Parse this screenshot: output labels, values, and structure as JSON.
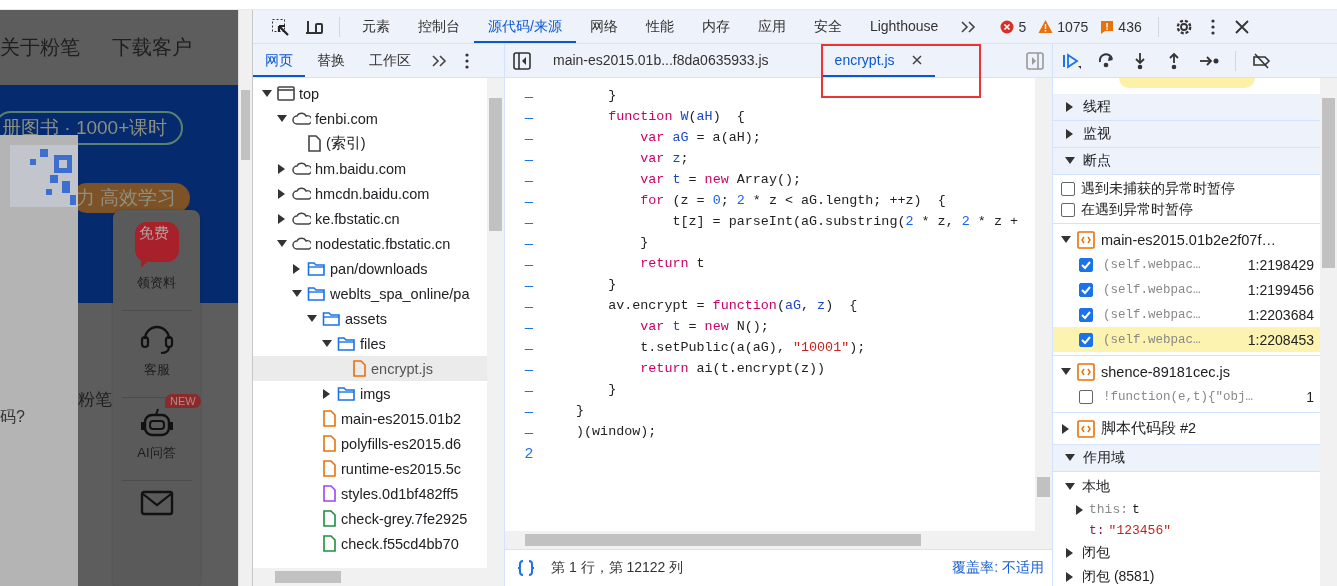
{
  "page": {
    "nav": [
      "关于粉笔",
      "下载客户"
    ],
    "pills": [
      {
        "text": "册图书 · 1000+课时",
        "kind": "outline"
      },
      {
        "text": "力 高效学习",
        "kind": "filled"
      }
    ],
    "login_hint": "码?",
    "brand_text": "粉笔",
    "side_menu": [
      {
        "kind": "gift",
        "badge": "免费",
        "label": "领资料"
      },
      {
        "kind": "headset",
        "label": "客服"
      },
      {
        "kind": "robot",
        "badge": "NEW",
        "label": "AI问答"
      },
      {
        "kind": "mail"
      }
    ]
  },
  "devtools": {
    "tabs": [
      {
        "label": "元素",
        "selected": false
      },
      {
        "label": "控制台",
        "selected": false
      },
      {
        "label": "源代码/来源",
        "selected": true
      },
      {
        "label": "网络",
        "selected": false
      },
      {
        "label": "性能",
        "selected": false
      },
      {
        "label": "内存",
        "selected": false
      },
      {
        "label": "应用",
        "selected": false
      },
      {
        "label": "安全",
        "selected": false
      },
      {
        "label": "Lighthouse",
        "selected": false
      }
    ],
    "counters": [
      {
        "kind": "error",
        "count": "5"
      },
      {
        "kind": "warning",
        "count": "1075"
      },
      {
        "kind": "issue",
        "count": "436"
      }
    ],
    "navigator": {
      "tabs": [
        {
          "label": "网页",
          "selected": true
        },
        {
          "label": "替换",
          "selected": false
        },
        {
          "label": "工作区",
          "selected": false
        }
      ],
      "tree": [
        {
          "label": "top",
          "kind": "frame",
          "expanded": true,
          "selected": false,
          "children": [
            {
              "label": "fenbi.com",
              "kind": "domain",
              "expanded": true,
              "selected": false,
              "children": [
                {
                  "label": "(索引)",
                  "kind": "document",
                  "selected": false
                }
              ]
            },
            {
              "label": "hm.baidu.com",
              "kind": "domain",
              "expanded": false,
              "selected": false
            },
            {
              "label": "hmcdn.baidu.com",
              "kind": "domain",
              "expanded": false,
              "selected": false
            },
            {
              "label": "ke.fbstatic.cn",
              "kind": "domain",
              "expanded": false,
              "selected": false
            },
            {
              "label": "nodestatic.fbstatic.cn",
              "kind": "domain",
              "expanded": true,
              "selected": false,
              "children": [
                {
                  "label": "pan/downloads",
                  "kind": "folder",
                  "expanded": false,
                  "selected": false
                },
                {
                  "label": "weblts_spa_online/pa",
                  "kind": "folder",
                  "expanded": true,
                  "selected": false,
                  "children": [
                    {
                      "label": "assets",
                      "kind": "folder",
                      "expanded": true,
                      "selected": false,
                      "children": [
                        {
                          "label": "files",
                          "kind": "folder",
                          "expanded": true,
                          "selected": false,
                          "children": [
                            {
                              "label": "encrypt.js",
                              "kind": "script",
                              "selected": true
                            }
                          ]
                        },
                        {
                          "label": "imgs",
                          "kind": "folder",
                          "expanded": false,
                          "selected": false
                        }
                      ]
                    },
                    {
                      "label": "main-es2015.01b2",
                      "kind": "script",
                      "selected": false
                    },
                    {
                      "label": "polyfills-es2015.d6",
                      "kind": "script",
                      "selected": false
                    },
                    {
                      "label": "runtime-es2015.5c",
                      "kind": "script",
                      "selected": false
                    },
                    {
                      "label": "styles.0d1bf482ff5",
                      "kind": "stylesheet",
                      "selected": false
                    },
                    {
                      "label": "check-grey.7fe2925",
                      "kind": "image",
                      "selected": false
                    },
                    {
                      "label": "check.f55cd4bb70",
                      "kind": "image",
                      "selected": false
                    }
                  ]
                }
              ]
            }
          ]
        }
      ]
    },
    "editor": {
      "tabs": [
        {
          "label": "main-es2015.01b...f8da0635933.js",
          "selected": false,
          "closable": false
        },
        {
          "label": "encrypt.js",
          "selected": true,
          "closable": true
        }
      ],
      "lines": [
        {
          "gutter": "–",
          "tokens": [
            {
              "t": "    }",
              "kind": "plain"
            }
          ]
        },
        {
          "gutter": "–",
          "tokens": [
            {
              "t": "    function ",
              "kind": "kw"
            },
            {
              "t": "W",
              "kind": "def"
            },
            {
              "t": "(",
              "kind": "plain"
            },
            {
              "t": "aH",
              "kind": "def"
            },
            {
              "t": ")  {",
              "kind": "plain"
            }
          ]
        },
        {
          "gutter": "–",
          "tokens": [
            {
              "t": "        var ",
              "kind": "kw"
            },
            {
              "t": "aG",
              "kind": "def"
            },
            {
              "t": " = a(aH);",
              "kind": "plain"
            }
          ]
        },
        {
          "gutter": "–",
          "tokens": [
            {
              "t": "        var ",
              "kind": "kw"
            },
            {
              "t": "z",
              "kind": "def"
            },
            {
              "t": ";",
              "kind": "plain"
            }
          ]
        },
        {
          "gutter": "–",
          "tokens": [
            {
              "t": "        var ",
              "kind": "kw"
            },
            {
              "t": "t",
              "kind": "def"
            },
            {
              "t": " = ",
              "kind": "plain"
            },
            {
              "t": "new",
              "kind": "kw"
            },
            {
              "t": " Array();",
              "kind": "plain"
            }
          ]
        },
        {
          "gutter": "–",
          "tokens": [
            {
              "t": "        for",
              "kind": "kw"
            },
            {
              "t": " (z = ",
              "kind": "plain"
            },
            {
              "t": "0",
              "kind": "num"
            },
            {
              "t": "; ",
              "kind": "plain"
            },
            {
              "t": "2",
              "kind": "num"
            },
            {
              "t": " * z < aG.length; ++z)  {",
              "kind": "plain"
            }
          ]
        },
        {
          "gutter": "–",
          "tokens": [
            {
              "t": "            t[z] = parseInt(aG.substring(",
              "kind": "plain"
            },
            {
              "t": "2",
              "kind": "num"
            },
            {
              "t": " * z, ",
              "kind": "plain"
            },
            {
              "t": "2",
              "kind": "num"
            },
            {
              "t": " * z +",
              "kind": "plain"
            }
          ]
        },
        {
          "gutter": "–",
          "tokens": [
            {
              "t": "        }",
              "kind": "plain"
            }
          ]
        },
        {
          "gutter": "–",
          "tokens": [
            {
              "t": "        return",
              "kind": "kw"
            },
            {
              "t": " t",
              "kind": "plain"
            }
          ]
        },
        {
          "gutter": "–",
          "tokens": [
            {
              "t": "    }",
              "kind": "plain"
            }
          ]
        },
        {
          "gutter": "–",
          "tokens": [
            {
              "t": "    av.encrypt = ",
              "kind": "plain"
            },
            {
              "t": "function",
              "kind": "kw"
            },
            {
              "t": "(",
              "kind": "plain"
            },
            {
              "t": "aG",
              "kind": "def"
            },
            {
              "t": ", ",
              "kind": "plain"
            },
            {
              "t": "z",
              "kind": "def"
            },
            {
              "t": ")  {",
              "kind": "plain"
            }
          ]
        },
        {
          "gutter": "–",
          "tokens": [
            {
              "t": "        var ",
              "kind": "kw"
            },
            {
              "t": "t",
              "kind": "def"
            },
            {
              "t": " = ",
              "kind": "plain"
            },
            {
              "t": "new",
              "kind": "kw"
            },
            {
              "t": " N();",
              "kind": "plain"
            }
          ]
        },
        {
          "gutter": "–",
          "tokens": [
            {
              "t": "        t.setPublic(a(aG), ",
              "kind": "plain"
            },
            {
              "t": "\"10001\"",
              "kind": "str"
            },
            {
              "t": ");",
              "kind": "plain"
            }
          ]
        },
        {
          "gutter": "–",
          "tokens": [
            {
              "t": "        return",
              "kind": "kw"
            },
            {
              "t": " ai(t.encrypt(z))",
              "kind": "plain"
            }
          ]
        },
        {
          "gutter": "–",
          "tokens": [
            {
              "t": "    }",
              "kind": "plain"
            }
          ]
        },
        {
          "gutter": "–",
          "tokens": [
            {
              "t": "}",
              "kind": "plain"
            }
          ]
        },
        {
          "gutter": "–",
          "tokens": [
            {
              "t": ")(window);",
              "kind": "plain"
            }
          ]
        },
        {
          "gutter": "2"
        }
      ],
      "status": {
        "position": "第 1 行，第 12122 列",
        "coverage": "覆盖率: 不适用"
      }
    },
    "debugger": {
      "sections": [
        {
          "title": "线程",
          "expanded": false
        },
        {
          "title": "监视",
          "expanded": false
        },
        {
          "title": "断点",
          "expanded": true,
          "kind": "breakpoints",
          "exceptions": [
            {
              "label": "遇到未捕获的异常时暂停",
              "checked": false
            },
            {
              "label": "在遇到异常时暂停",
              "checked": false
            }
          ],
          "files": [
            {
              "name": "main-es2015.01b2e2f07f…",
              "expanded": true,
              "breakpoints": [
                {
                  "code": "(self.webpac…",
                  "location": "1:2198429",
                  "checked": true,
                  "selected": false
                },
                {
                  "code": "(self.webpac…",
                  "location": "1:2199456",
                  "checked": true,
                  "selected": false
                },
                {
                  "code": "(self.webpac…",
                  "location": "1:2203684",
                  "checked": true,
                  "selected": false
                },
                {
                  "code": "(self.webpac…",
                  "location": "1:2208453",
                  "checked": true,
                  "selected": true
                }
              ]
            },
            {
              "name": "shence-89181cec.js",
              "expanded": true,
              "breakpoints": [
                {
                  "code": "!function(e,t){\"obj…",
                  "location": "1",
                  "checked": false,
                  "selected": false
                }
              ]
            },
            {
              "name": "脚本代码段 #2",
              "expanded": false
            }
          ]
        },
        {
          "title": "作用域",
          "expanded": true,
          "kind": "scope",
          "scopes": [
            {
              "name": "本地",
              "expanded": true,
              "vars": [
                {
                  "name": "this:",
                  "value": "t",
                  "kind": "object",
                  "expanded": false
                },
                {
                  "name": "t:",
                  "value": "\"123456\"",
                  "kind": "string"
                }
              ]
            },
            {
              "name": "闭包",
              "expanded": false
            },
            {
              "name": "闭包 (8581)",
              "expanded": false
            }
          ]
        }
      ]
    }
  }
}
